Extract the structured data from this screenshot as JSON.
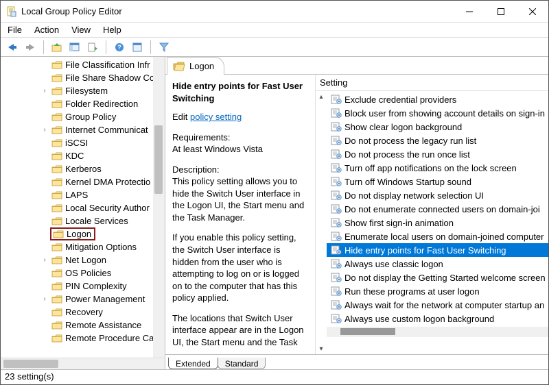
{
  "window": {
    "title": "Local Group Policy Editor"
  },
  "menu": {
    "file": "File",
    "action": "Action",
    "view": "View",
    "help": "Help"
  },
  "tree": {
    "items": [
      {
        "label": "File Classification Infr",
        "chev": ""
      },
      {
        "label": "File Share Shadow Co",
        "chev": ""
      },
      {
        "label": "Filesystem",
        "chev": "›"
      },
      {
        "label": "Folder Redirection",
        "chev": ""
      },
      {
        "label": "Group Policy",
        "chev": ""
      },
      {
        "label": "Internet Communicat",
        "chev": "›"
      },
      {
        "label": "iSCSI",
        "chev": ""
      },
      {
        "label": "KDC",
        "chev": ""
      },
      {
        "label": "Kerberos",
        "chev": ""
      },
      {
        "label": "Kernel DMA Protectio",
        "chev": ""
      },
      {
        "label": "LAPS",
        "chev": ""
      },
      {
        "label": "Local Security Author",
        "chev": ""
      },
      {
        "label": "Locale Services",
        "chev": ""
      },
      {
        "label": "Logon",
        "chev": "",
        "highlight": true
      },
      {
        "label": "Mitigation Options",
        "chev": ""
      },
      {
        "label": "Net Logon",
        "chev": "›"
      },
      {
        "label": "OS Policies",
        "chev": ""
      },
      {
        "label": "PIN Complexity",
        "chev": ""
      },
      {
        "label": "Power Management",
        "chev": "›"
      },
      {
        "label": "Recovery",
        "chev": ""
      },
      {
        "label": "Remote Assistance",
        "chev": ""
      },
      {
        "label": "Remote Procedure Ca",
        "chev": ""
      }
    ]
  },
  "header": {
    "title": "Logon"
  },
  "description": {
    "title": "Hide entry points for Fast User Switching",
    "edit_prefix": "Edit",
    "edit_link": "policy setting ",
    "req_label": "Requirements:",
    "req_value": "At least Windows Vista",
    "desc_label": "Description:",
    "desc_p1": "This policy setting allows you to hide the Switch User interface in the Logon UI, the Start menu and the Task Manager.",
    "desc_p2": "If you enable this policy setting, the Switch User interface is hidden from the user who is attempting to log on or is logged on to the computer that has this policy applied.",
    "desc_p3": "The locations that Switch User interface appear are in the Logon UI, the Start menu and the Task"
  },
  "settings": {
    "header": "Setting",
    "items": [
      {
        "label": "Exclude credential providers"
      },
      {
        "label": "Block user from showing account details on sign-in"
      },
      {
        "label": "Show clear logon background"
      },
      {
        "label": "Do not process the legacy run list"
      },
      {
        "label": "Do not process the run once list"
      },
      {
        "label": "Turn off app notifications on the lock screen"
      },
      {
        "label": "Turn off Windows Startup sound"
      },
      {
        "label": "Do not display network selection UI"
      },
      {
        "label": "Do not enumerate connected users on domain-joi"
      },
      {
        "label": "Show first sign-in animation"
      },
      {
        "label": "Enumerate local users on domain-joined computer"
      },
      {
        "label": "Hide entry points for Fast User Switching",
        "selected": true
      },
      {
        "label": "Always use classic logon"
      },
      {
        "label": "Do not display the Getting Started welcome screen"
      },
      {
        "label": "Run these programs at user logon"
      },
      {
        "label": "Always wait for the network at computer startup an"
      },
      {
        "label": "Always use custom logon background"
      }
    ]
  },
  "tabs": {
    "extended": "Extended",
    "standard": "Standard"
  },
  "status": {
    "text": "23 setting(s)"
  }
}
